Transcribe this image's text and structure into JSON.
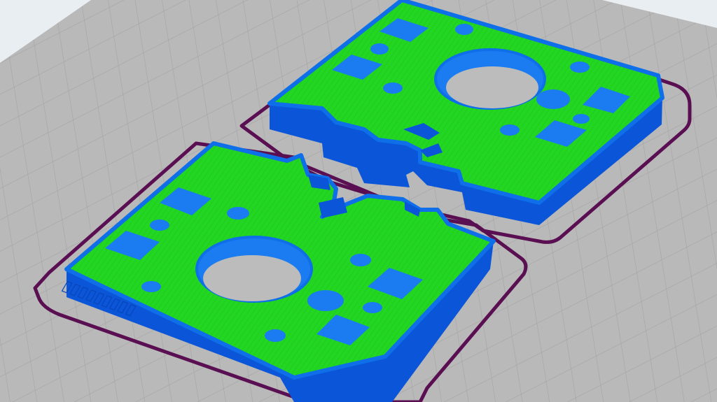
{
  "viewport": {
    "view": "slicer-3d-preview",
    "background_color": "#e9eef2",
    "bed_color": "#b8b8b8",
    "bed_grid_color": "#a1a1a1",
    "skirt_color": "#5a0f52",
    "infill_color": "#20d420",
    "wall_color": "#0f6fe8",
    "wall_side_color": "#0b55d8",
    "hole_wall_color": "#1a7cf0",
    "cutout_color": "#bcbcbc"
  },
  "model": {
    "embossed_text": "▯▯▯▯▯▯▯▯▯"
  }
}
